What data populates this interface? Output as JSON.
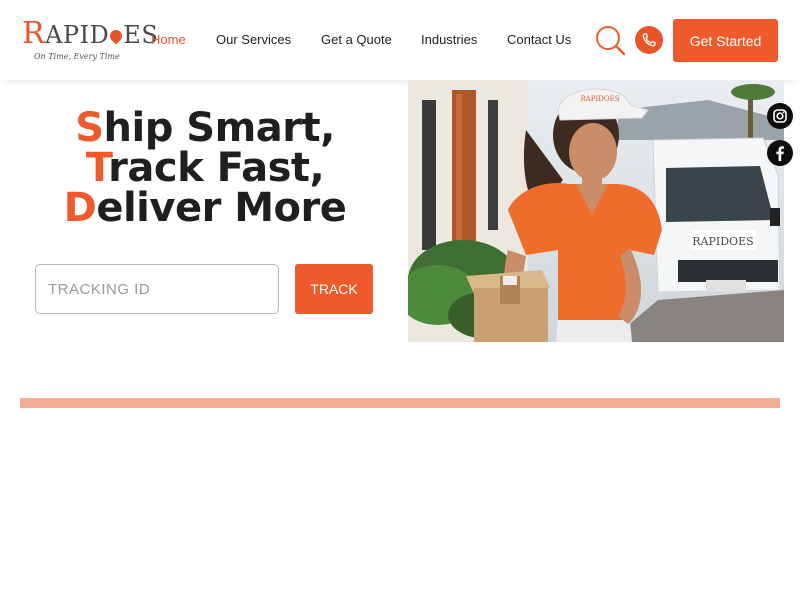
{
  "brand": {
    "name_first": "R",
    "name_mid": "APID",
    "name_end": "ES",
    "tagline": "On Time, Every Time",
    "accent": "#ee5a2b"
  },
  "nav": {
    "items": [
      {
        "label": "Home",
        "active": true
      },
      {
        "label": "Our Services",
        "active": false
      },
      {
        "label": "Get a Quote",
        "active": false
      },
      {
        "label": "Industries",
        "active": false
      },
      {
        "label": "Contact Us",
        "active": false
      }
    ],
    "search_icon": "search-icon",
    "phone_icon": "phone-icon",
    "cta_label": "Get Started"
  },
  "hero": {
    "lines": [
      {
        "first": "S",
        "rest": "hip Smart,"
      },
      {
        "first": "T",
        "rest": "rack Fast,"
      },
      {
        "first": "D",
        "rest": "eliver More"
      }
    ],
    "tracking_placeholder": "TRACKING ID",
    "track_label": "TRACK",
    "van_brand": "RAPIDOES",
    "cap_brand": "RAPIDOES"
  },
  "social": {
    "instagram_icon": "instagram-icon",
    "facebook_icon": "facebook-icon"
  }
}
